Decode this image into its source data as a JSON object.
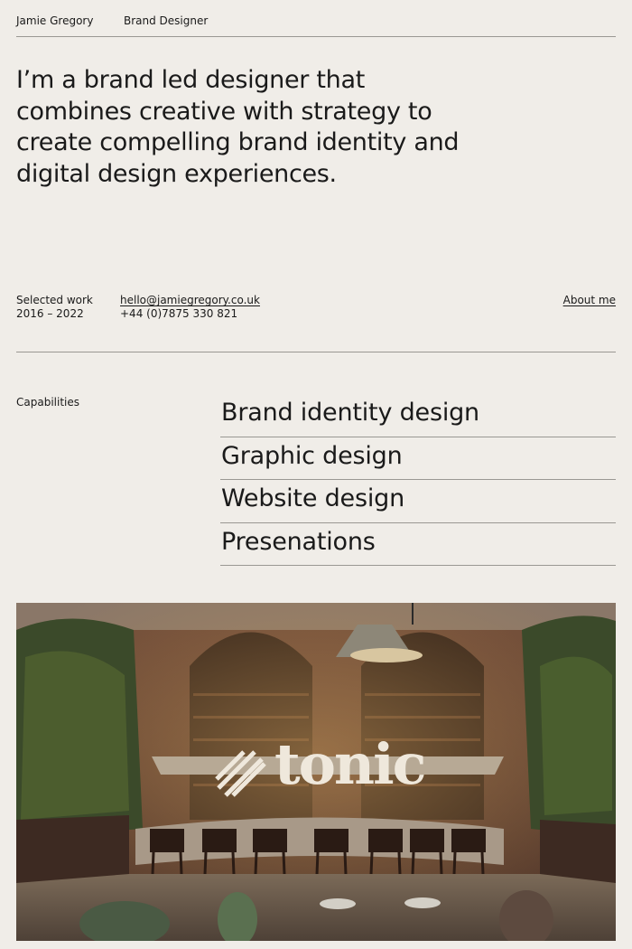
{
  "header": {
    "name": "Jamie Gregory",
    "role": "Brand Designer"
  },
  "intro": {
    "text": "I’m a brand led designer that combines creative with strategy to create compelling brand identity and digital design experiences."
  },
  "info": {
    "selected_work_label": "Selected work",
    "selected_work_years": "2016 – 2022",
    "email": "hello@jamiegregory.co.uk",
    "phone": "+44 (0)7875 330 821",
    "about_link": "About me"
  },
  "capabilities": {
    "label": "Capabilities",
    "items": [
      "Brand identity design",
      "Graphic design",
      "Website design",
      "Presenations"
    ]
  },
  "project": {
    "logo_text": "tonic"
  }
}
